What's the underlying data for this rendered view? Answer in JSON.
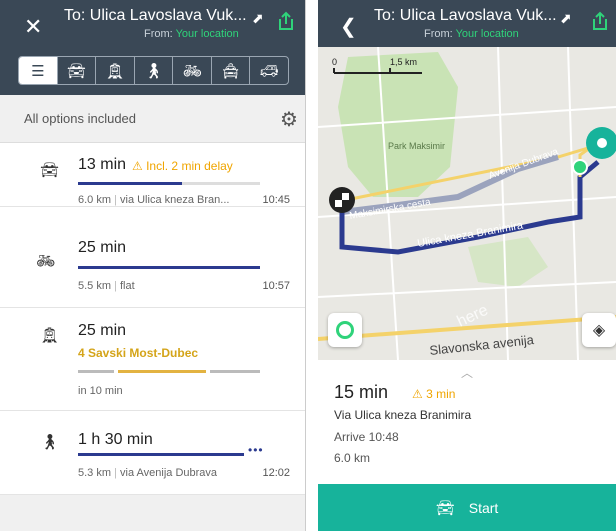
{
  "left": {
    "header": {
      "close_icon": "close-icon",
      "title": "To: Ulica Lavoslava Vuk...",
      "from_prefix": "From:",
      "from_value": "Your location"
    },
    "modes": [
      "list",
      "car",
      "transit",
      "walk",
      "bike",
      "taxi",
      "carshare"
    ],
    "options_label": "All options included",
    "routes": [
      {
        "mode": "car",
        "time": "13 min",
        "warning": "Incl. 2 min delay",
        "meta_a": "6.0 km",
        "meta_b": "via Ulica kneza Bran...",
        "arrive": "10:45",
        "progress": 0.57
      },
      {
        "mode": "bike",
        "time": "25 min",
        "meta_a": "5.5 km",
        "meta_b": "flat",
        "arrive": "10:57",
        "progress": 1.0
      },
      {
        "mode": "transit",
        "time": "25 min",
        "line": "4 Savski Most-Dubec",
        "meta_a": "in 10 min"
      },
      {
        "mode": "walk",
        "time": "1 h 30 min",
        "meta_a": "5.3 km",
        "meta_b": "via Avenija Dubrava",
        "arrive": "12:02"
      }
    ]
  },
  "right": {
    "header": {
      "back_icon": "chevron-left-icon",
      "title": "To: Ulica Lavoslava Vuk...",
      "from_prefix": "From:",
      "from_value": "Your location"
    },
    "map": {
      "scale_start": "0",
      "scale_end": "1,5 km",
      "labels": [
        "Park Maksimir",
        "Maksimirska cesta",
        "Avenija Dubrava",
        "Ulica kneza Branimira",
        "Slavonska avenija",
        "here"
      ]
    },
    "summary": {
      "time": "15 min",
      "warning": "3 min",
      "via": "Via Ulica kneza Branimira",
      "arrive": "Arrive 10:48",
      "distance": "6.0 km"
    },
    "start_label": "Start"
  },
  "colors": {
    "header": "#3a4856",
    "accent_green": "#2fd37a",
    "warning": "#f0a500",
    "route_blue": "#2b3a8f",
    "start_button": "#17b39b"
  }
}
